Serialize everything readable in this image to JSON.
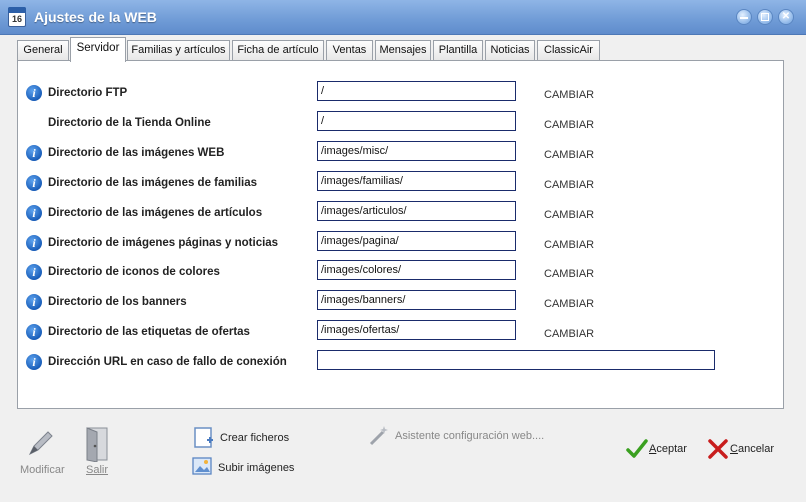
{
  "window": {
    "title": "Ajustes de la WEB",
    "app_icon_text": "16"
  },
  "tabs": [
    {
      "label": "General",
      "active": false
    },
    {
      "label": "Servidor",
      "active": true
    },
    {
      "label": "Familias y artículos",
      "active": false
    },
    {
      "label": "Ficha de artículo",
      "active": false
    },
    {
      "label": "Ventas",
      "active": false
    },
    {
      "label": "Mensajes",
      "active": false
    },
    {
      "label": "Plantilla",
      "active": false
    },
    {
      "label": "Noticias",
      "active": false
    },
    {
      "label": "ClassicAir",
      "active": false
    }
  ],
  "rows": [
    {
      "label": "Directorio FTP",
      "value": "/",
      "info_icon": true,
      "change": "CAMBIAR"
    },
    {
      "label": "Directorio de la Tienda Online",
      "value": "/",
      "info_icon": false,
      "change": "CAMBIAR"
    },
    {
      "label": "Directorio de las imágenes WEB",
      "value": "/images/misc/",
      "info_icon": true,
      "change": "CAMBIAR"
    },
    {
      "label": "Directorio de las imágenes de familias",
      "value": "/images/familias/",
      "info_icon": true,
      "change": "CAMBIAR"
    },
    {
      "label": "Directorio de las imágenes de artículos",
      "value": "/images/articulos/",
      "info_icon": true,
      "change": "CAMBIAR"
    },
    {
      "label": "Directorio de imágenes páginas y noticias",
      "value": "/images/pagina/",
      "info_icon": true,
      "change": "CAMBIAR"
    },
    {
      "label": "Directorio de iconos de colores",
      "value": "/images/colores/",
      "info_icon": true,
      "change": "CAMBIAR"
    },
    {
      "label": "Directorio de los banners",
      "value": "/images/banners/",
      "info_icon": true,
      "change": "CAMBIAR"
    },
    {
      "label": "Directorio de las etiquetas de ofertas",
      "value": "/images/ofertas/",
      "info_icon": true,
      "change": "CAMBIAR"
    },
    {
      "label": "Dirección URL en caso de fallo de conexión",
      "value": "",
      "info_icon": true,
      "change": ""
    }
  ],
  "footer": {
    "modificar": "Modificar",
    "salir": "Salir",
    "crear_ficheros": "Crear ficheros",
    "subir_imagenes": "Subir imágenes",
    "asistente": "Asistente configuración web....",
    "aceptar_ul": "A",
    "aceptar_rest": "ceptar",
    "cancelar_ul": "C",
    "cancelar_rest": "ancelar"
  },
  "colors": {
    "title_bar": "#6f9bd6",
    "input_border": "#1a2b6b",
    "info_icon": "#1559b5",
    "accept_green": "#3aa020",
    "cancel_red": "#c81d1d"
  }
}
